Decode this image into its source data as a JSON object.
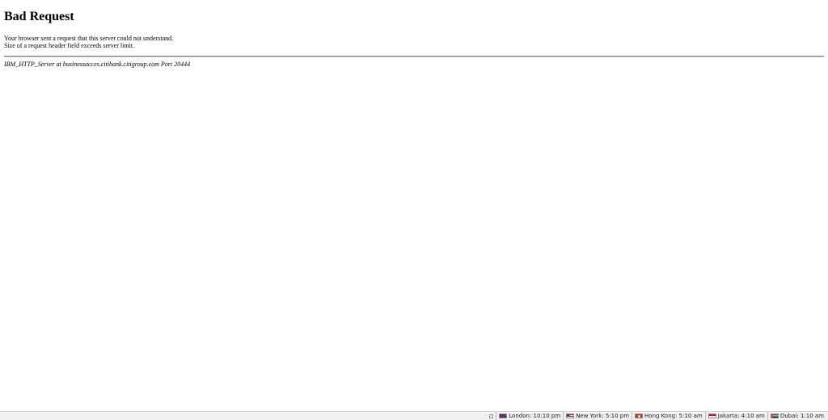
{
  "page": {
    "heading": "Bad Request",
    "message_lines": [
      "Your browser sent a request that this server could not understand.",
      "Size of a request header field exceeds server limit."
    ],
    "server_signature": "IBM_HTTP_Server at businessacces.citibank.citigroup.com Port 20444"
  },
  "clock_bar": {
    "clocks": [
      {
        "flag": "uk-flag-icon",
        "text": "London: 10:10 pm"
      },
      {
        "flag": "us-flag-icon",
        "text": "New York: 5:10 pm"
      },
      {
        "flag": "hk-flag-icon",
        "text": "Hong Kong: 5:10 am"
      },
      {
        "flag": "id-flag-icon",
        "text": "Jakarta: 4:10 am"
      },
      {
        "flag": "uae-flag-icon",
        "text": "Dubai: 1:10 am"
      }
    ]
  }
}
